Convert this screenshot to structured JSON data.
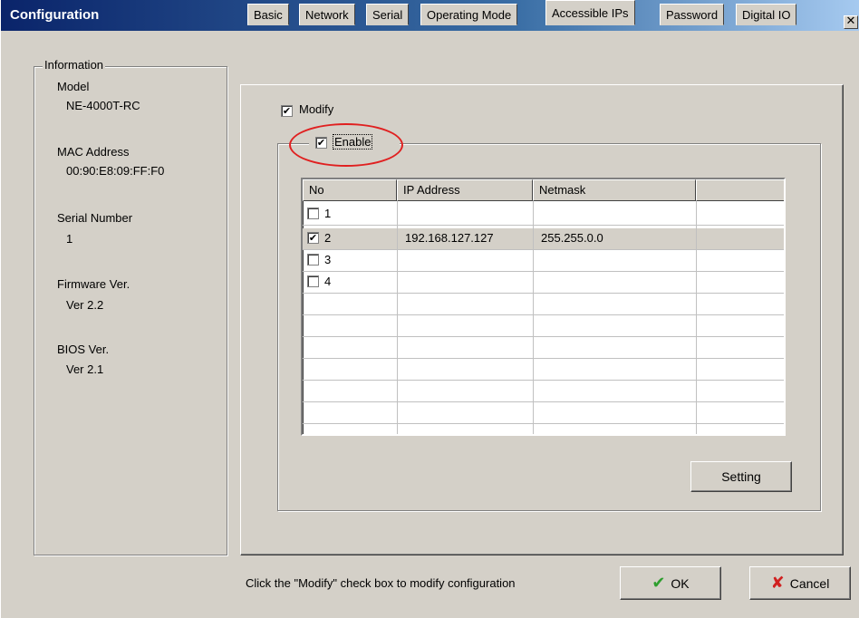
{
  "window": {
    "title": "Configuration",
    "close_glyph": "✕"
  },
  "info": {
    "legend": "Information",
    "model_label": "Model",
    "model_value": "NE-4000T-RC",
    "mac_label": "MAC Address",
    "mac_value": "00:90:E8:09:FF:F0",
    "serial_label": "Serial Number",
    "serial_value": "1",
    "firmware_label": "Firmware Ver.",
    "firmware_value": "Ver 2.2",
    "bios_label": "BIOS Ver.",
    "bios_value": "Ver 2.1"
  },
  "tabs": [
    "Basic",
    "Network",
    "Serial",
    "Operating Mode",
    "Accessible IPs",
    "Password",
    "Digital IO"
  ],
  "active_tab": "Accessible IPs",
  "modify": {
    "label": "Modify",
    "checked": true
  },
  "enable": {
    "label": "Enable",
    "checked": true
  },
  "table": {
    "columns": [
      "No",
      "IP Address",
      "Netmask",
      ""
    ],
    "rows": [
      {
        "no": "1",
        "checked": false,
        "ip": "",
        "mask": ""
      },
      {
        "no": "2",
        "checked": true,
        "ip": "192.168.127.127",
        "mask": "255.255.0.0"
      },
      {
        "no": "3",
        "checked": false,
        "ip": "",
        "mask": ""
      },
      {
        "no": "4",
        "checked": false,
        "ip": "",
        "mask": ""
      }
    ]
  },
  "buttons": {
    "setting": "Setting",
    "ok": "OK",
    "cancel": "Cancel"
  },
  "status_text": "Click the \"Modify\" check box to modify configuration",
  "colors": {
    "title_gradient_start": "#0a246a",
    "highlight_circle": "#e02020",
    "ok_check": "#2e9e2e",
    "cancel_x": "#d02020"
  }
}
